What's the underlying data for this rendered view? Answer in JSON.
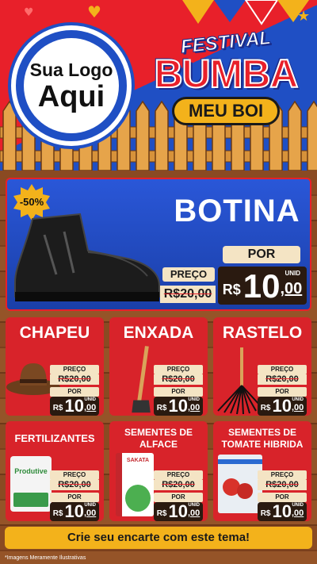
{
  "header": {
    "logo_line1": "Sua Logo",
    "logo_line2": "Aqui",
    "festival": "FESTIVAL",
    "bumba": "BUMBA",
    "meu_boi": "MEU BOI"
  },
  "hero": {
    "discount": "-50%",
    "name": "BOTINA",
    "preco_label": "PREÇO",
    "old_price": "R$20,00",
    "por_label": "POR",
    "currency": "R$",
    "price_int": "10",
    "price_cents": ",00",
    "unit": "UNID"
  },
  "products": [
    {
      "name": "CHAPEU",
      "preco_label": "PREÇO",
      "old_price": "R$20,00",
      "por_label": "POR",
      "currency": "R$",
      "price_int": "10",
      "price_cents": ",00",
      "unit": "UNID"
    },
    {
      "name": "ENXADA",
      "preco_label": "PREÇO",
      "old_price": "R$20,00",
      "por_label": "POR",
      "currency": "R$",
      "price_int": "10",
      "price_cents": ",00",
      "unit": "UNID"
    },
    {
      "name": "RASTELO",
      "preco_label": "PREÇO",
      "old_price": "R$20,00",
      "por_label": "POR",
      "currency": "R$",
      "price_int": "10",
      "price_cents": ",00",
      "unit": "UNID"
    },
    {
      "name": "FERTILIZANTES",
      "preco_label": "PREÇO",
      "old_price": "R$20,00",
      "por_label": "POR",
      "currency": "R$",
      "price_int": "10",
      "price_cents": ",00",
      "unit": "UNID",
      "pack_label": "Produtive"
    },
    {
      "name_l1": "SEMENTES DE",
      "name_l2": "ALFACE",
      "preco_label": "PREÇO",
      "old_price": "R$20,00",
      "por_label": "POR",
      "currency": "R$",
      "price_int": "10",
      "price_cents": ",00",
      "unit": "UNID",
      "pack_label": "SAKATA"
    },
    {
      "name_l1": "SEMENTES DE",
      "name_l2": "TOMATE HIBRIDA",
      "preco_label": "PREÇO",
      "old_price": "R$20,00",
      "por_label": "POR",
      "currency": "R$",
      "price_int": "10",
      "price_cents": ",00",
      "unit": "UNID"
    }
  ],
  "footer": {
    "cta": "Crie seu encarte com este tema!",
    "note": "*Imagens Meramente Ilustrativas"
  },
  "colors": {
    "red": "#e8202a",
    "blue": "#1f4fc4",
    "yellow": "#f3b21b",
    "wood": "#7a3f1c",
    "tag": "#f4e4c4"
  }
}
